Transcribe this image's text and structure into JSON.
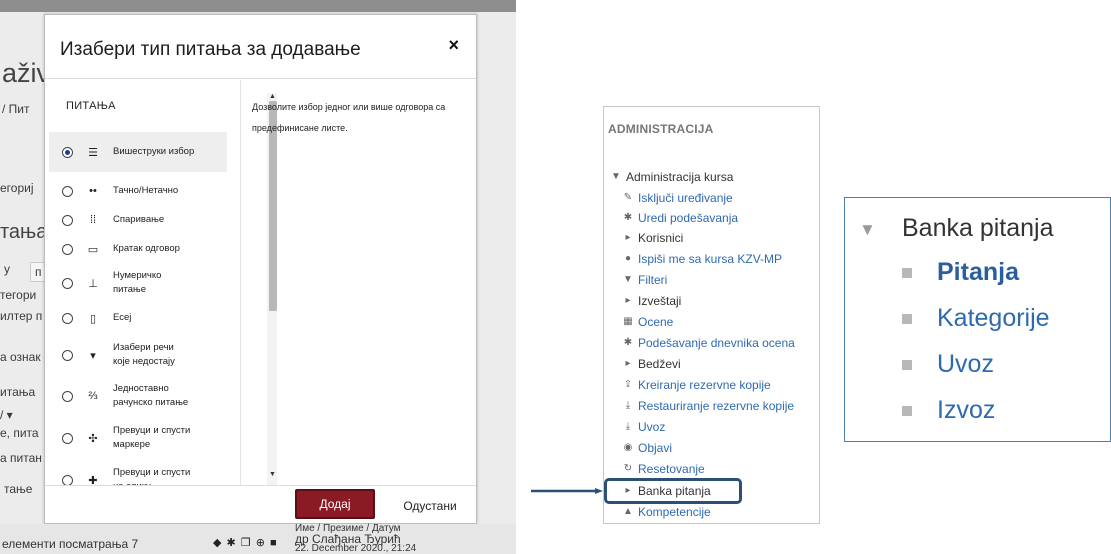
{
  "left": {
    "background_fragments": [
      "aživ",
      "/ Пит",
      "егориј",
      "тања",
      "у",
      "п",
      "тегори",
      "илтер п",
      "а ознак",
      "итања",
      "/ ▾",
      "е, пита",
      "а питан",
      "тање"
    ],
    "modal": {
      "title": "Изабери тип питања за додавање",
      "close": "×",
      "section_header": "ПИТАЊА",
      "options": [
        {
          "label": "Вишеструки избор",
          "icon": "list-icon",
          "selected": true
        },
        {
          "label": "Тачно/Нетачно",
          "icon": "true-false-icon",
          "selected": false
        },
        {
          "label": "Спаривање",
          "icon": "matching-icon",
          "selected": false
        },
        {
          "label": "Кратак одговор",
          "icon": "short-answer-icon",
          "selected": false
        },
        {
          "label": "Нумеричко питање",
          "icon": "numerical-icon",
          "selected": false
        },
        {
          "label": "Есеј",
          "icon": "essay-icon",
          "selected": false
        },
        {
          "label": "Изабери речи које недостају",
          "icon": "select-missing-words-icon",
          "selected": false
        },
        {
          "label": "Једноставно рачунско питање",
          "icon": "calculated-simple-icon",
          "selected": false
        },
        {
          "label": "Превуци и спусти маркере",
          "icon": "drag-markers-icon",
          "selected": false
        },
        {
          "label": "Превуци и спусти на слику",
          "icon": "drag-drop-image-icon",
          "selected": false
        }
      ],
      "description": "Дозволите избор једног или више одговора са предефинисане листе.",
      "add_button": "Додај",
      "cancel_button": "Одустани"
    },
    "footer": {
      "text": "елементи посматрања 7",
      "meta_top": "Име / Презиме / Датум",
      "meta_name": "др Слађана Ђурић",
      "meta_date": "22. December 2020., 21:24"
    }
  },
  "administracija": {
    "header": "ADMINISTRACIJA",
    "items": [
      {
        "label": "Administracija kursa",
        "icon": "caret-down-icon",
        "link": false
      },
      {
        "label": "Isključi uređivanje",
        "icon": "pencil-icon",
        "link": true
      },
      {
        "label": "Uredi podešavanja",
        "icon": "gear-icon",
        "link": true
      },
      {
        "label": "Korisnici",
        "icon": "caret-right-icon",
        "link": false
      },
      {
        "label": "Ispiši me sa kursa KZV-MP",
        "icon": "user-icon",
        "link": true
      },
      {
        "label": "Filteri",
        "icon": "filter-icon",
        "link": true
      },
      {
        "label": "Izveštaji",
        "icon": "caret-right-icon",
        "link": false
      },
      {
        "label": "Ocene",
        "icon": "table-icon",
        "link": true
      },
      {
        "label": "Podešavanje dnevnika ocena",
        "icon": "gear-icon",
        "link": true
      },
      {
        "label": "Bedževi",
        "icon": "caret-right-icon",
        "link": false
      },
      {
        "label": "Kreiranje rezervne kopije",
        "icon": "upload-icon",
        "link": true
      },
      {
        "label": "Restauriranje rezervne kopije",
        "icon": "download-icon",
        "link": true
      },
      {
        "label": "Uvoz",
        "icon": "download-icon",
        "link": true
      },
      {
        "label": "Objavi",
        "icon": "globe-icon",
        "link": true
      },
      {
        "label": "Resetovanje",
        "icon": "reset-icon",
        "link": true
      },
      {
        "label": "Banka pitanja",
        "icon": "caret-right-icon",
        "link": false
      },
      {
        "label": "Kompetencije",
        "icon": "competency-icon",
        "link": true
      }
    ]
  },
  "banka": {
    "header": "Banka pitanja",
    "items": [
      {
        "label": "Pitanja"
      },
      {
        "label": "Kategorije"
      },
      {
        "label": "Uvoz"
      },
      {
        "label": "Izvoz"
      }
    ]
  }
}
